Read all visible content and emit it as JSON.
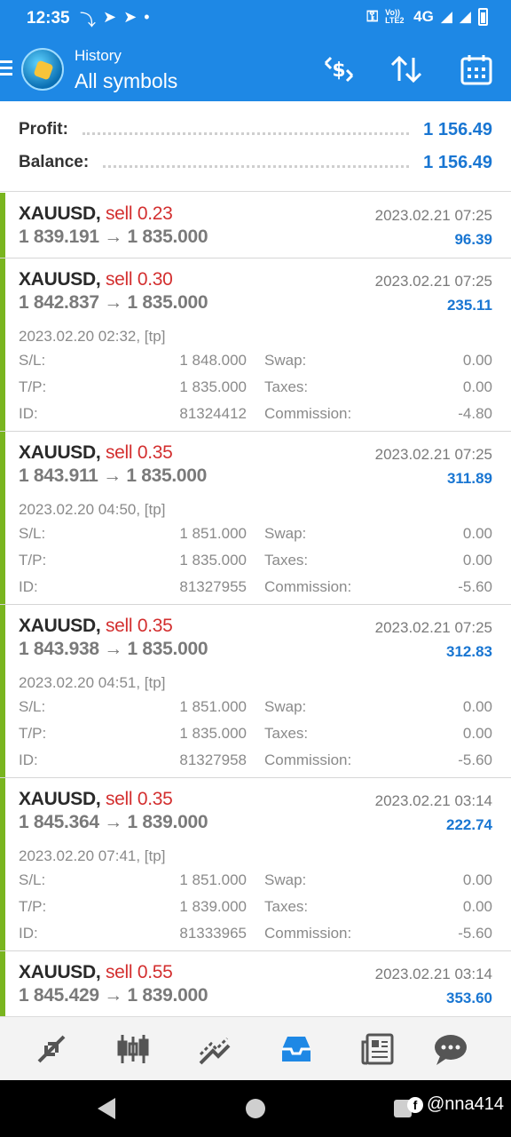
{
  "status_bar": {
    "time": "12:35",
    "network": "4G",
    "volte": "Vo)) LTE2"
  },
  "header": {
    "subtitle": "History",
    "title": "All symbols",
    "app_color": "#1e88e5"
  },
  "summary": {
    "profit_label": "Profit:",
    "profit_value": "1 156.49",
    "balance_label": "Balance:",
    "balance_value": "1 156.49"
  },
  "trades": [
    {
      "symbol": "XAUUSD,",
      "side": "sell 0.23",
      "prices": "1 839.191 → 1 835.000",
      "close_time": "2023.02.21 07:25",
      "profit": "96.39"
    },
    {
      "symbol": "XAUUSD,",
      "side": "sell 0.30",
      "prices": "1 842.837 → 1 835.000",
      "close_time": "2023.02.21 07:25",
      "profit": "235.11",
      "open_info": "2023.02.20 02:32, [tp]",
      "sl_label": "S/L:",
      "sl": "1 848.000",
      "swap_label": "Swap:",
      "swap": "0.00",
      "tp_label": "T/P:",
      "tp": "1 835.000",
      "taxes_label": "Taxes:",
      "taxes": "0.00",
      "id_label": "ID:",
      "id": "81324412",
      "commission_label": "Commission:",
      "commission": "-4.80"
    },
    {
      "symbol": "XAUUSD,",
      "side": "sell 0.35",
      "prices": "1 843.911 → 1 835.000",
      "close_time": "2023.02.21 07:25",
      "profit": "311.89",
      "open_info": "2023.02.20 04:50, [tp]",
      "sl_label": "S/L:",
      "sl": "1 851.000",
      "swap_label": "Swap:",
      "swap": "0.00",
      "tp_label": "T/P:",
      "tp": "1 835.000",
      "taxes_label": "Taxes:",
      "taxes": "0.00",
      "id_label": "ID:",
      "id": "81327955",
      "commission_label": "Commission:",
      "commission": "-5.60"
    },
    {
      "symbol": "XAUUSD,",
      "side": "sell 0.35",
      "prices": "1 843.938 → 1 835.000",
      "close_time": "2023.02.21 07:25",
      "profit": "312.83",
      "open_info": "2023.02.20 04:51, [tp]",
      "sl_label": "S/L:",
      "sl": "1 851.000",
      "swap_label": "Swap:",
      "swap": "0.00",
      "tp_label": "T/P:",
      "tp": "1 835.000",
      "taxes_label": "Taxes:",
      "taxes": "0.00",
      "id_label": "ID:",
      "id": "81327958",
      "commission_label": "Commission:",
      "commission": "-5.60"
    },
    {
      "symbol": "XAUUSD,",
      "side": "sell 0.35",
      "prices": "1 845.364 → 1 839.000",
      "close_time": "2023.02.21 03:14",
      "profit": "222.74",
      "open_info": "2023.02.20 07:41, [tp]",
      "sl_label": "S/L:",
      "sl": "1 851.000",
      "swap_label": "Swap:",
      "swap": "0.00",
      "tp_label": "T/P:",
      "tp": "1 839.000",
      "taxes_label": "Taxes:",
      "taxes": "0.00",
      "id_label": "ID:",
      "id": "81333965",
      "commission_label": "Commission:",
      "commission": "-5.60"
    },
    {
      "symbol": "XAUUSD,",
      "side": "sell 0.55",
      "prices": "1 845.429 → 1 839.000",
      "close_time": "2023.02.21 03:14",
      "profit": "353.60"
    }
  ],
  "bottom_nav": {
    "items": [
      "quotes-icon",
      "chart-icon",
      "trade-icon",
      "history-icon",
      "news-icon",
      "chat-icon"
    ],
    "active": "history-icon",
    "active_color": "#1e88e5"
  },
  "watermark": {
    "badge": "f",
    "text": "@nna414"
  }
}
